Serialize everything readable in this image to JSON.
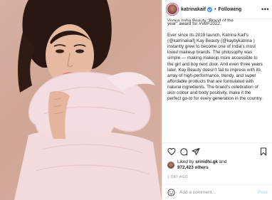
{
  "header": {
    "username": "katrinakaif",
    "separator": "•",
    "follow_status": "Following",
    "more_label": "•••"
  },
  "caption": {
    "clipped_line": "Vogue India Beauty \"Brand of the",
    "first_line": "year\" award for #VBF2022.",
    "paragraphs": [
      "Ever since its 2019 launch, Katrina Kaif's (@katrinakaif) Kay Beauty (@kaybykatrina ) instantly grew to become one of India's most loved makeup brands. The philosophy was simple — making makeup more accessible to the girl and boy next door. And even three years later, Kay Beauty doesn't fail to impress with its array of high-performance, trendy, and super affordable products that are formulated with natural ingredients. The brand's celebration of skin colour and body positivity, make it the perfect go-to for every generation in the country."
    ]
  },
  "actions": {
    "icons": [
      "heart-icon",
      "comment-icon",
      "share-icon",
      "bookmark-icon"
    ],
    "liked_by_prefix": "Liked by ",
    "liked_by_user": "srinidhi.gk",
    "and_label": " and",
    "likes_count": "972,423 others",
    "time_ago": "1 DAY AGO"
  },
  "comment": {
    "placeholder": "Add a comment...",
    "post_label": "Post"
  },
  "colors": {
    "verified": "#3897f0",
    "post_button": "#b2dffc",
    "photo_background": "#d4ab9c"
  }
}
